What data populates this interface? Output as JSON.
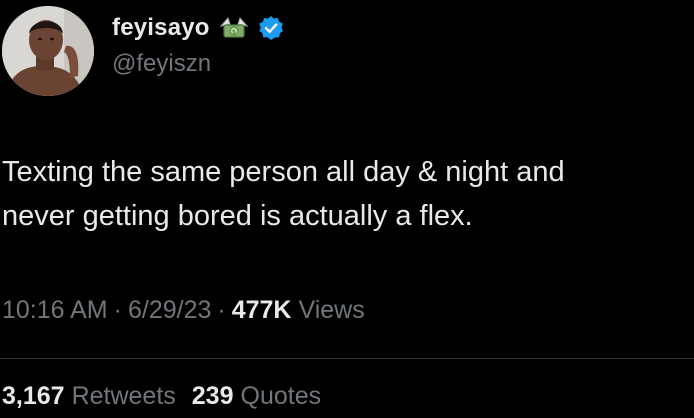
{
  "user": {
    "display_name": "feyisayo",
    "handle": "@feyiszn",
    "verified_badge_icon": "verified-checkmark-icon",
    "name_emoji_icon": "money-with-wings-emoji",
    "badge_color": "#1d9bf0"
  },
  "tweet": {
    "text_lines": [
      "Texting the same person all day & night and",
      "never getting bored is actually a flex."
    ]
  },
  "meta": {
    "time": "10:16 AM",
    "separator": "·",
    "date": "6/29/23",
    "views_count": "477K",
    "views_label": "Views"
  },
  "stats": {
    "retweets_count": "3,167",
    "retweets_label": "Retweets",
    "quotes_count": "239",
    "quotes_label": "Quotes"
  },
  "colors": {
    "background": "#000000",
    "primary_text": "#e7e9ea",
    "secondary_text": "#71767b",
    "divider": "#2f3336"
  }
}
